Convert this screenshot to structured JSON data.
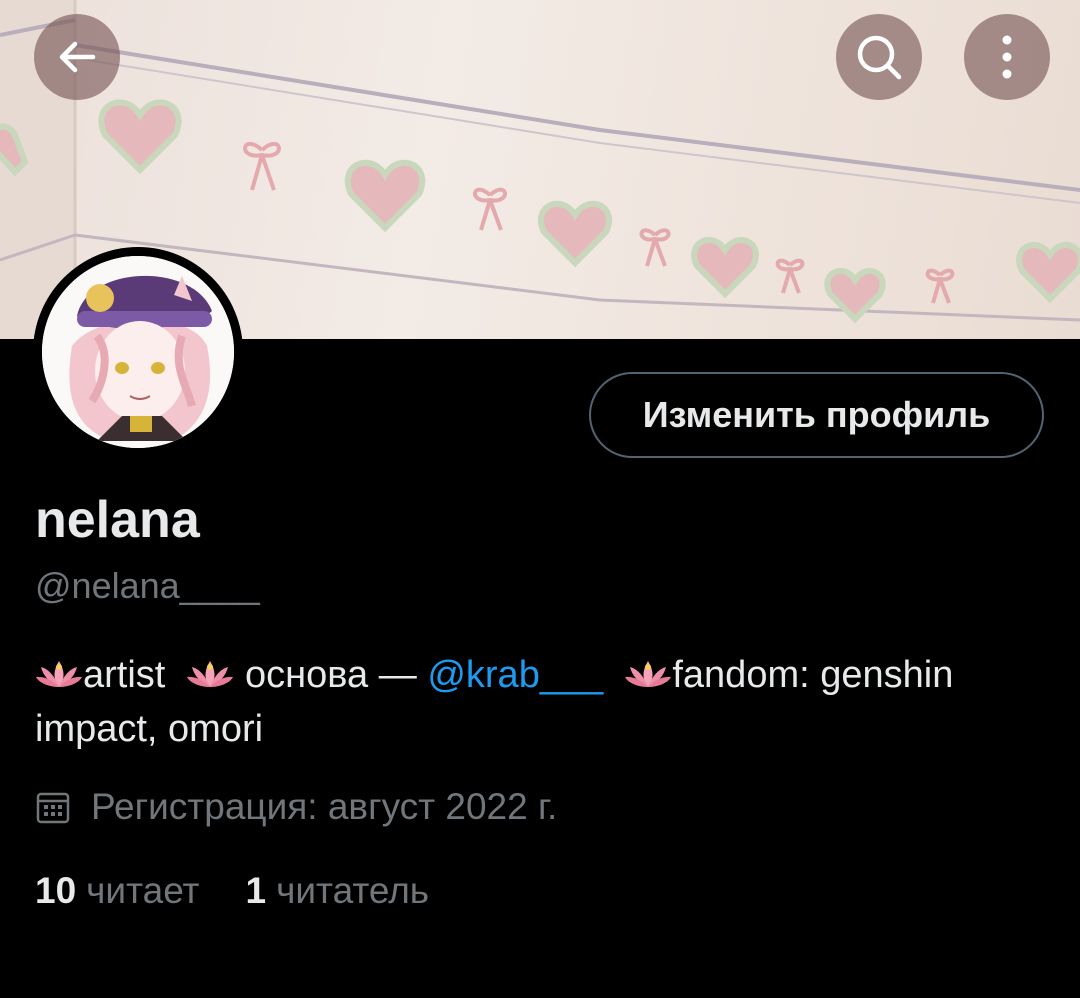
{
  "header": {
    "back_icon": "arrow-left-icon",
    "search_icon": "search-icon",
    "more_icon": "more-vertical-icon"
  },
  "profile": {
    "edit_button_label": "Изменить профиль",
    "display_name": "nelana",
    "handle": "@nelana____",
    "bio": {
      "emoji": "lotus-icon",
      "part1": "artist",
      "part2": "основа —",
      "mention": "@krab___",
      "part3": "fandom: genshin impact, omori"
    },
    "joined": "Регистрация: август 2022 г.",
    "following_count": "10",
    "following_label": "читает",
    "followers_count": "1",
    "followers_label": "читатель"
  },
  "colors": {
    "background": "#000000",
    "text": "#e7e9ea",
    "muted": "#71767b",
    "link": "#1d9bf0",
    "border": "#536471"
  }
}
